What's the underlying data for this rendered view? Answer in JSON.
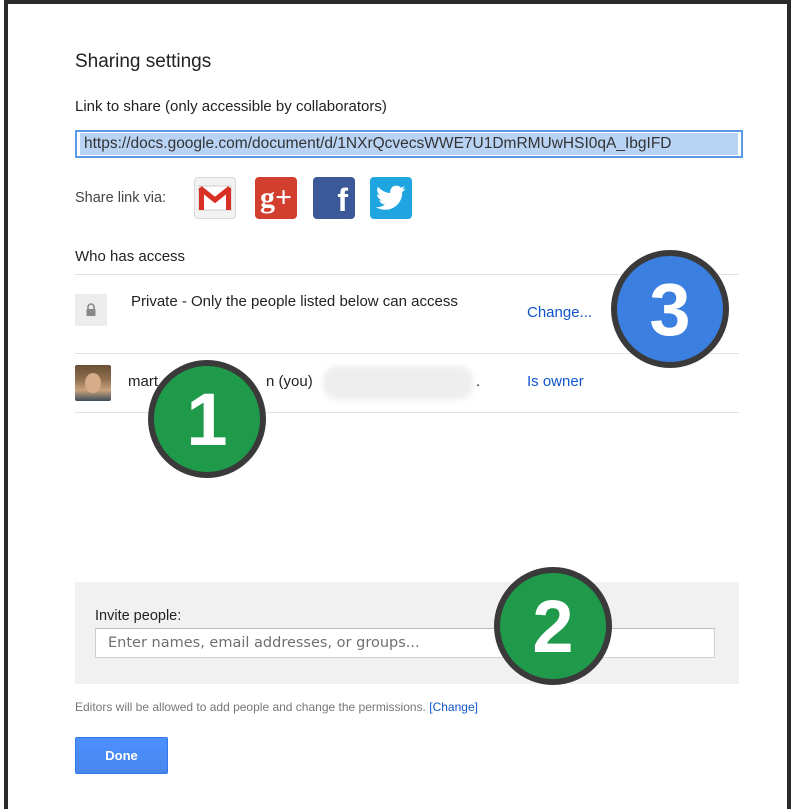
{
  "dialog": {
    "title": "Sharing settings",
    "link_label": "Link to share (only accessible by collaborators)",
    "link_value": "https://docs.google.com/document/d/1NXrQcvecsWWE7U1DmRMUwHSI0qA_IbgIFD",
    "share_via_label": "Share link via:",
    "share_services": [
      {
        "name": "Gmail",
        "icon": "gmail-icon"
      },
      {
        "name": "Google+",
        "icon": "google-plus-icon",
        "glyph": "g+"
      },
      {
        "name": "Facebook",
        "icon": "facebook-icon",
        "glyph": "f"
      },
      {
        "name": "Twitter",
        "icon": "twitter-icon"
      }
    ],
    "who_has_access_label": "Who has access",
    "access_rows": [
      {
        "icon": "lock-icon",
        "text": "Private - Only the people listed below can access",
        "action": "Change..."
      },
      {
        "icon": "avatar",
        "name": "mart",
        "name_tail": "n (you)",
        "email_suffix": ".",
        "role": "Is owner"
      }
    ],
    "invite": {
      "label": "Invite people:",
      "placeholder": "Enter names, email addresses, or groups...",
      "value": ""
    },
    "footnote": {
      "text": "Editors will be allowed to add people and change the permissions.",
      "link_open": "[",
      "link": "Change",
      "link_close": "]"
    },
    "done_label": "Done"
  },
  "callouts": [
    {
      "number": "1",
      "color": "#1f9a4b"
    },
    {
      "number": "2",
      "color": "#1f9a4b"
    },
    {
      "number": "3",
      "color": "#3b7fe0"
    }
  ],
  "colors": {
    "link_blue": "#1155cc",
    "done_button": "#4787ed",
    "highlight": "#b9d3f5"
  }
}
